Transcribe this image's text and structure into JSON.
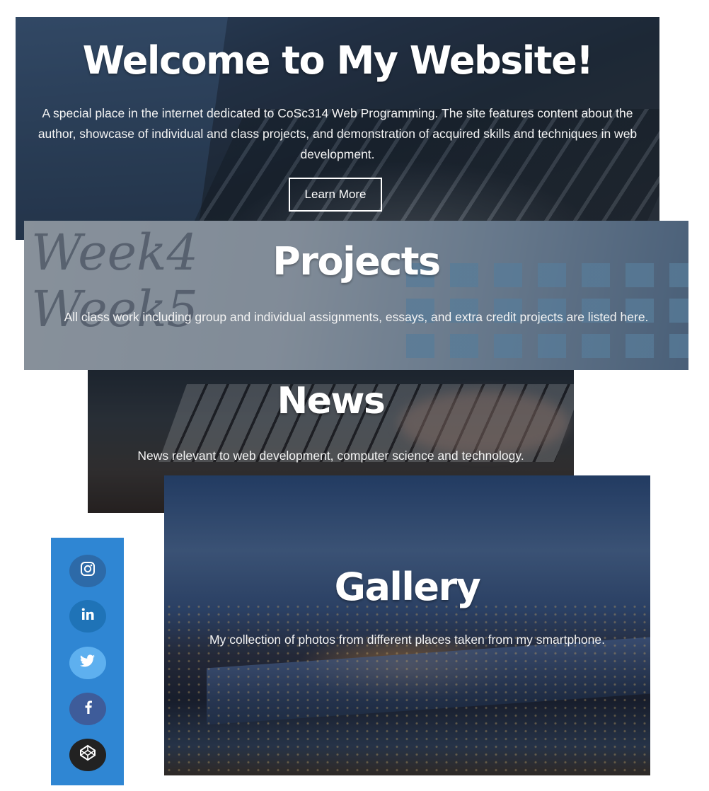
{
  "hero": {
    "title": "Welcome to My Website!",
    "description": "A special place in the internet dedicated to CoSc314 Web Programming. The site features content about the author, showcase of individual and class projects, and demonstration of acquired skills and techniques in web development.",
    "button_label": "Learn More"
  },
  "projects": {
    "title": "Projects",
    "description": "All class work including group and individual assignments, essays, and extra credit projects are listed here."
  },
  "news": {
    "title": "News",
    "description": "News relevant to web development, computer science and technology."
  },
  "gallery": {
    "title": "Gallery",
    "description": "My collection of photos from different places taken from my smartphone."
  },
  "social": {
    "accent_color": "#2f86d3",
    "items": [
      {
        "icon": "instagram-icon",
        "color": "#2d6aa8"
      },
      {
        "icon": "linkedin-icon",
        "color": "#1f73b7"
      },
      {
        "icon": "twitter-icon",
        "color": "#5eb0ef"
      },
      {
        "icon": "facebook-icon",
        "color": "#3e5c9a"
      },
      {
        "icon": "codepen-icon",
        "color": "#222222"
      }
    ]
  }
}
